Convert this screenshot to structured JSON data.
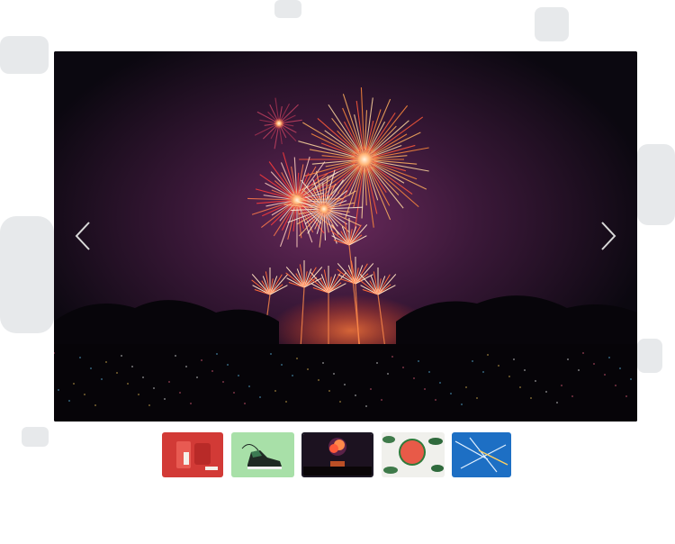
{
  "gallery": {
    "main_image": {
      "subject": "fireworks-over-crowd",
      "colors": {
        "sky": "#0b0810",
        "glow": "#5a2450",
        "burst_orange": "#ff8a3c",
        "burst_red": "#ff3b3b",
        "burst_white": "#fff2e0"
      }
    },
    "nav": {
      "prev_icon": "chevron-left-icon",
      "next_icon": "chevron-right-icon",
      "arrow_color": "#d9d9d9"
    },
    "thumbnails": [
      {
        "name": "thumb-red-camera",
        "subject": "red-camera",
        "color": "#d23a36",
        "active": false
      },
      {
        "name": "thumb-sneaker",
        "subject": "sneaker-on-mint",
        "color": "#a8e0a8",
        "active": false
      },
      {
        "name": "thumb-fireworks",
        "subject": "fireworks",
        "color": "#1c1220",
        "active": true
      },
      {
        "name": "thumb-watermelon",
        "subject": "watermelon-on-leaves",
        "color": "#f0f0ec",
        "active": false
      },
      {
        "name": "thumb-blue-paint",
        "subject": "blue-abstract",
        "color": "#1d6fc4",
        "active": false
      }
    ]
  }
}
